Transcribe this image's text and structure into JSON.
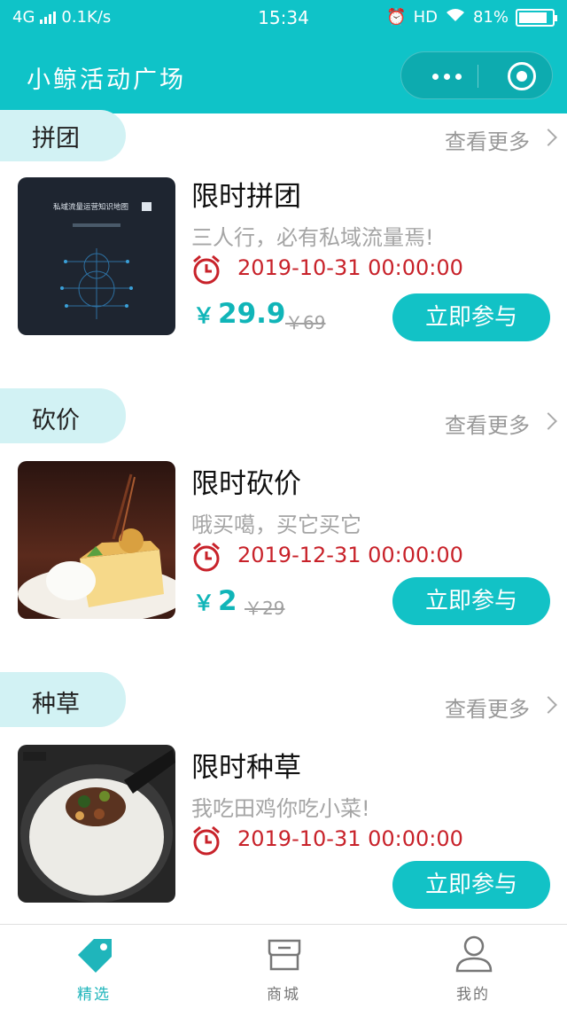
{
  "status_bar": {
    "network": "4G",
    "speed": "0.1K/s",
    "time": "15:34",
    "hd": "HD",
    "battery": "81%"
  },
  "header": {
    "title": "小鲸活动广场"
  },
  "common": {
    "more_label": "查看更多",
    "join_label": "立即参与",
    "currency": "￥"
  },
  "sections": [
    {
      "tab": "拼团",
      "item": {
        "name": "限时拼团",
        "desc": "三人行，必有私域流量焉!",
        "date": "2019-10-31 00:00:00",
        "price": "29.9",
        "old_price": "￥69",
        "thumb_text": "私域流量运营知识地图"
      }
    },
    {
      "tab": "砍价",
      "item": {
        "name": "限时砍价",
        "desc": "哦买噶，买它买它",
        "date": "2019-12-31 00:00:00",
        "price": "2",
        "old_price": "￥29"
      }
    },
    {
      "tab": "种草",
      "item": {
        "name": "限时种草",
        "desc": "我吃田鸡你吃小菜!",
        "date": "2019-10-31 00:00:00"
      }
    }
  ],
  "tabbar": {
    "items": [
      {
        "label": "精选",
        "icon": "tag-icon",
        "active": true
      },
      {
        "label": "商城",
        "icon": "store-icon",
        "active": false
      },
      {
        "label": "我的",
        "icon": "user-icon",
        "active": false
      }
    ]
  },
  "colors": {
    "primary": "#0fc3c8",
    "accent_text": "#10b5b8",
    "date_red": "#c8222a"
  }
}
